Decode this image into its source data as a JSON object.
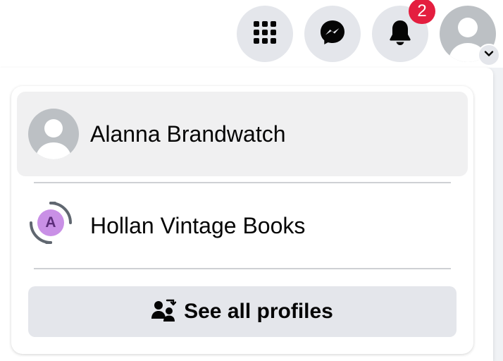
{
  "topbar": {
    "menu_icon": "grid-menu-icon",
    "messenger_icon": "messenger-icon",
    "notifications_icon": "bell-icon",
    "notification_count": "2",
    "account_icon": "default-avatar-icon",
    "account_chevron": "chevron-down-icon"
  },
  "profiles": {
    "current": {
      "name": "Alanna Brandwatch",
      "icon": "default-avatar-icon"
    },
    "other": {
      "name": "Hollan Vintage Books",
      "avatar_letter": "A",
      "icon": "switch-profile-icon"
    },
    "see_all_label": "See all profiles",
    "see_all_icon": "profiles-switch-icon"
  },
  "colors": {
    "badge": "#e41e3f",
    "button_bg": "#e4e6eb",
    "page_avatar": "#c990e6",
    "page_avatar_letter": "#5c2d7a"
  }
}
